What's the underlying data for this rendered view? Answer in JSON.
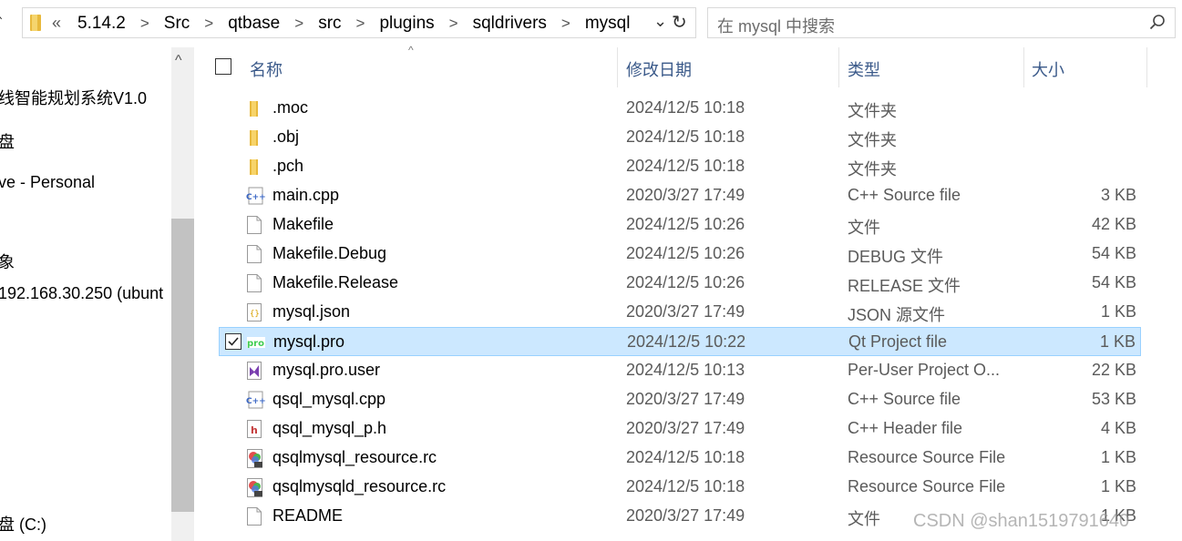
{
  "address_bar": {
    "overflow_glyph": "«",
    "crumbs": [
      "5.14.2",
      "Src",
      "qtbase",
      "src",
      "plugins",
      "sqldrivers",
      "mysql"
    ],
    "separator": ">"
  },
  "search": {
    "placeholder": "在 mysql 中搜索"
  },
  "sidebar": {
    "items": [
      {
        "label": "线智能规划系统V1.0"
      },
      {
        "label": "盘"
      },
      {
        "label": "ve - Personal"
      },
      {
        "label": "象"
      },
      {
        "label": "192.168.30.250 (ubunt"
      },
      {
        "label": "盘 (C:)"
      }
    ]
  },
  "columns": {
    "name": "名称",
    "date": "修改日期",
    "type": "类型",
    "size": "大小"
  },
  "files": [
    {
      "name": ".moc",
      "date": "2024/12/5 10:18",
      "type": "文件夹",
      "size": "",
      "icon": "folder-icon"
    },
    {
      "name": ".obj",
      "date": "2024/12/5 10:18",
      "type": "文件夹",
      "size": "",
      "icon": "folder-icon"
    },
    {
      "name": ".pch",
      "date": "2024/12/5 10:18",
      "type": "文件夹",
      "size": "",
      "icon": "folder-icon"
    },
    {
      "name": "main.cpp",
      "date": "2020/3/27 17:49",
      "type": "C++ Source file",
      "size": "3 KB",
      "icon": "cpp-file-icon"
    },
    {
      "name": "Makefile",
      "date": "2024/12/5 10:26",
      "type": "文件",
      "size": "42 KB",
      "icon": "blank-file-icon"
    },
    {
      "name": "Makefile.Debug",
      "date": "2024/12/5 10:26",
      "type": "DEBUG 文件",
      "size": "54 KB",
      "icon": "blank-file-icon"
    },
    {
      "name": "Makefile.Release",
      "date": "2024/12/5 10:26",
      "type": "RELEASE 文件",
      "size": "54 KB",
      "icon": "blank-file-icon"
    },
    {
      "name": "mysql.json",
      "date": "2020/3/27 17:49",
      "type": "JSON 源文件",
      "size": "1 KB",
      "icon": "json-file-icon"
    },
    {
      "name": "mysql.pro",
      "date": "2024/12/5 10:22",
      "type": "Qt Project file",
      "size": "1 KB",
      "icon": "qt-pro-file-icon",
      "selected": true
    },
    {
      "name": "mysql.pro.user",
      "date": "2024/12/5 10:13",
      "type": "Per-User Project O...",
      "size": "22 KB",
      "icon": "visual-studio-file-icon"
    },
    {
      "name": "qsql_mysql.cpp",
      "date": "2020/3/27 17:49",
      "type": "C++ Source file",
      "size": "53 KB",
      "icon": "cpp-file-icon"
    },
    {
      "name": "qsql_mysql_p.h",
      "date": "2020/3/27 17:49",
      "type": "C++ Header file",
      "size": "4 KB",
      "icon": "header-file-icon"
    },
    {
      "name": "qsqlmysql_resource.rc",
      "date": "2024/12/5 10:18",
      "type": "Resource Source File",
      "size": "1 KB",
      "icon": "rc-file-icon"
    },
    {
      "name": "qsqlmysqld_resource.rc",
      "date": "2024/12/5 10:18",
      "type": "Resource Source File",
      "size": "1 KB",
      "icon": "rc-file-icon"
    },
    {
      "name": "README",
      "date": "2020/3/27 17:49",
      "type": "文件",
      "size": "1 KB",
      "icon": "blank-file-icon"
    }
  ],
  "watermark": "CSDN @shan1519791640",
  "colors": {
    "selection_bg": "#cce8ff",
    "selection_border": "#99d1ff",
    "header_text": "#3b5a8a",
    "folder": "#e8b93c"
  }
}
